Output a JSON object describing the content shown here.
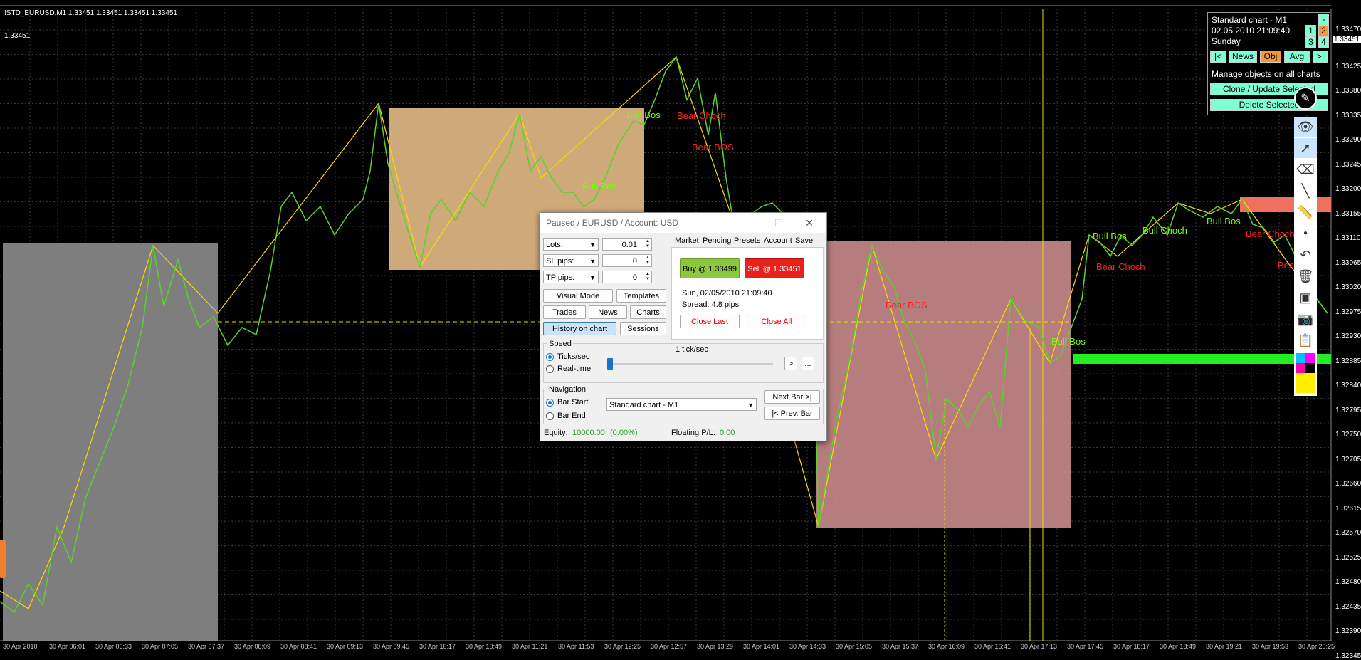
{
  "chart": {
    "symbol_header": "!STD_EURUSD,M1  1.33451 1.33451 1.33451 1.33451",
    "bid_label": "1.33451",
    "price_labels": [
      "1.33470",
      "1.33451",
      "1.33425",
      "1.33380",
      "1.33335",
      "1.33290",
      "1.33245",
      "1.33200",
      "1.33155",
      "1.33110",
      "1.33065",
      "1.33020",
      "1.32975",
      "1.32930",
      "1.32885",
      "1.32840",
      "1.32795",
      "1.32750",
      "1.32705",
      "1.32660",
      "1.32615",
      "1.32570",
      "1.32525",
      "1.32480",
      "1.32435",
      "1.32390",
      "1.32345"
    ],
    "time_labels": [
      "30 Apr 2010",
      "30 Apr 06:01",
      "30 Apr 06:33",
      "30 Apr 07:05",
      "30 Apr 07:37",
      "30 Apr 08:09",
      "30 Apr 08:41",
      "30 Apr 09:13",
      "30 Apr 09:45",
      "30 Apr 10:17",
      "30 Apr 10:49",
      "30 Apr 11:21",
      "30 Apr 11:53",
      "30 Apr 12:25",
      "30 Apr 12:57",
      "30 Apr 13:29",
      "30 Apr 14:01",
      "30 Apr 14:33",
      "30 Apr 15:05",
      "30 Apr 15:37",
      "30 Apr 16:09",
      "30 Apr 16:41",
      "30 Apr 17:13",
      "30 Apr 17:45",
      "30 Apr 18:17",
      "30 Apr 18:49",
      "30 Apr 19:21",
      "30 Apr 19:53",
      "30 Apr 20:25"
    ],
    "annotations": [
      {
        "text": "Bull Bos",
        "color": "#7cfc00"
      },
      {
        "text": "Bear Choch",
        "color": "#ff2020"
      },
      {
        "text": "Bear BOS",
        "color": "#ff2020"
      },
      {
        "text": "Bear BOS",
        "color": "#ff2020"
      },
      {
        "text": "Bull Bos",
        "color": "#7cfc00"
      },
      {
        "text": "Bull Bos",
        "color": "#7cfc00"
      },
      {
        "text": "Bear Choch",
        "color": "#ff2020"
      },
      {
        "text": "Bull Choch",
        "color": "#7cfc00"
      },
      {
        "text": "Bull Bos",
        "color": "#7cfc00"
      },
      {
        "text": "Bear Choch",
        "color": "#ff2020"
      },
      {
        "text": "Bear",
        "color": "#ff2020"
      },
      {
        "text": "Bull Bos",
        "color": "#7cfc00"
      }
    ]
  },
  "info_panel": {
    "title": "Standard chart - M1",
    "datetime": "02.05.2010  21:09:40",
    "day": "Sunday",
    "minus": "-",
    "num1": "1",
    "num2": "2",
    "num3": "3",
    "num4": "4",
    "nav_first": "|<",
    "news": "News",
    "obj": "Obj",
    "avg": "Avg",
    "nav_last": ">|",
    "manage_text": "Manage objects on all charts",
    "clone_button": "Clone / Update Selected",
    "delete_button": "Delete Selected"
  },
  "dialog": {
    "title": "Paused / EURUSD / Account: USD",
    "lots_label": "Lots:",
    "lots_value": "0.01",
    "sl_label": "SL pips:",
    "sl_value": "0",
    "tp_label": "TP pips:",
    "tp_value": "0",
    "visual_mode": "Visual Mode",
    "templates": "Templates",
    "trades": "Trades",
    "news": "News",
    "charts": "Charts",
    "history_on_chart": "History on chart",
    "sessions": "Sessions",
    "tabs": [
      "Market",
      "Pending",
      "Presets",
      "Account",
      "Save"
    ],
    "buy_button": "Buy @ 1.33499",
    "sell_button": "Sell @ 1.33451",
    "date_info": "Sun, 02/05/2010  21:09:40",
    "spread": "Spread: 4.8 pips",
    "close_last": "Close Last",
    "close_all": "Close All",
    "speed_label": "Speed",
    "ticks_sec": "Ticks/sec",
    "real_time": "Real-time",
    "speed_value": "1 tick/sec",
    "next_speed": ">",
    "more": "...",
    "navigation_label": "Navigation",
    "bar_start": "Bar Start",
    "bar_end": "Bar End",
    "chart_select": "Standard chart - M1",
    "next_bar": "Next Bar >|",
    "prev_bar": "|< Prev. Bar",
    "equity_label": "Equity:",
    "equity_value": "10000.00",
    "equity_pct": "(0.00%)",
    "floating_label": "Floating P/L:",
    "floating_value": "0.00"
  },
  "colors": {
    "bull": "#7cfc00",
    "bear": "#ff2020",
    "grid": "#3a3a3a",
    "buy_bg": "#8dc63f",
    "sell_bg": "#e8211d",
    "zone_gray": "#8c8c8c",
    "zone_tan": "#d9b382",
    "zone_pink": "#c98b8b"
  }
}
